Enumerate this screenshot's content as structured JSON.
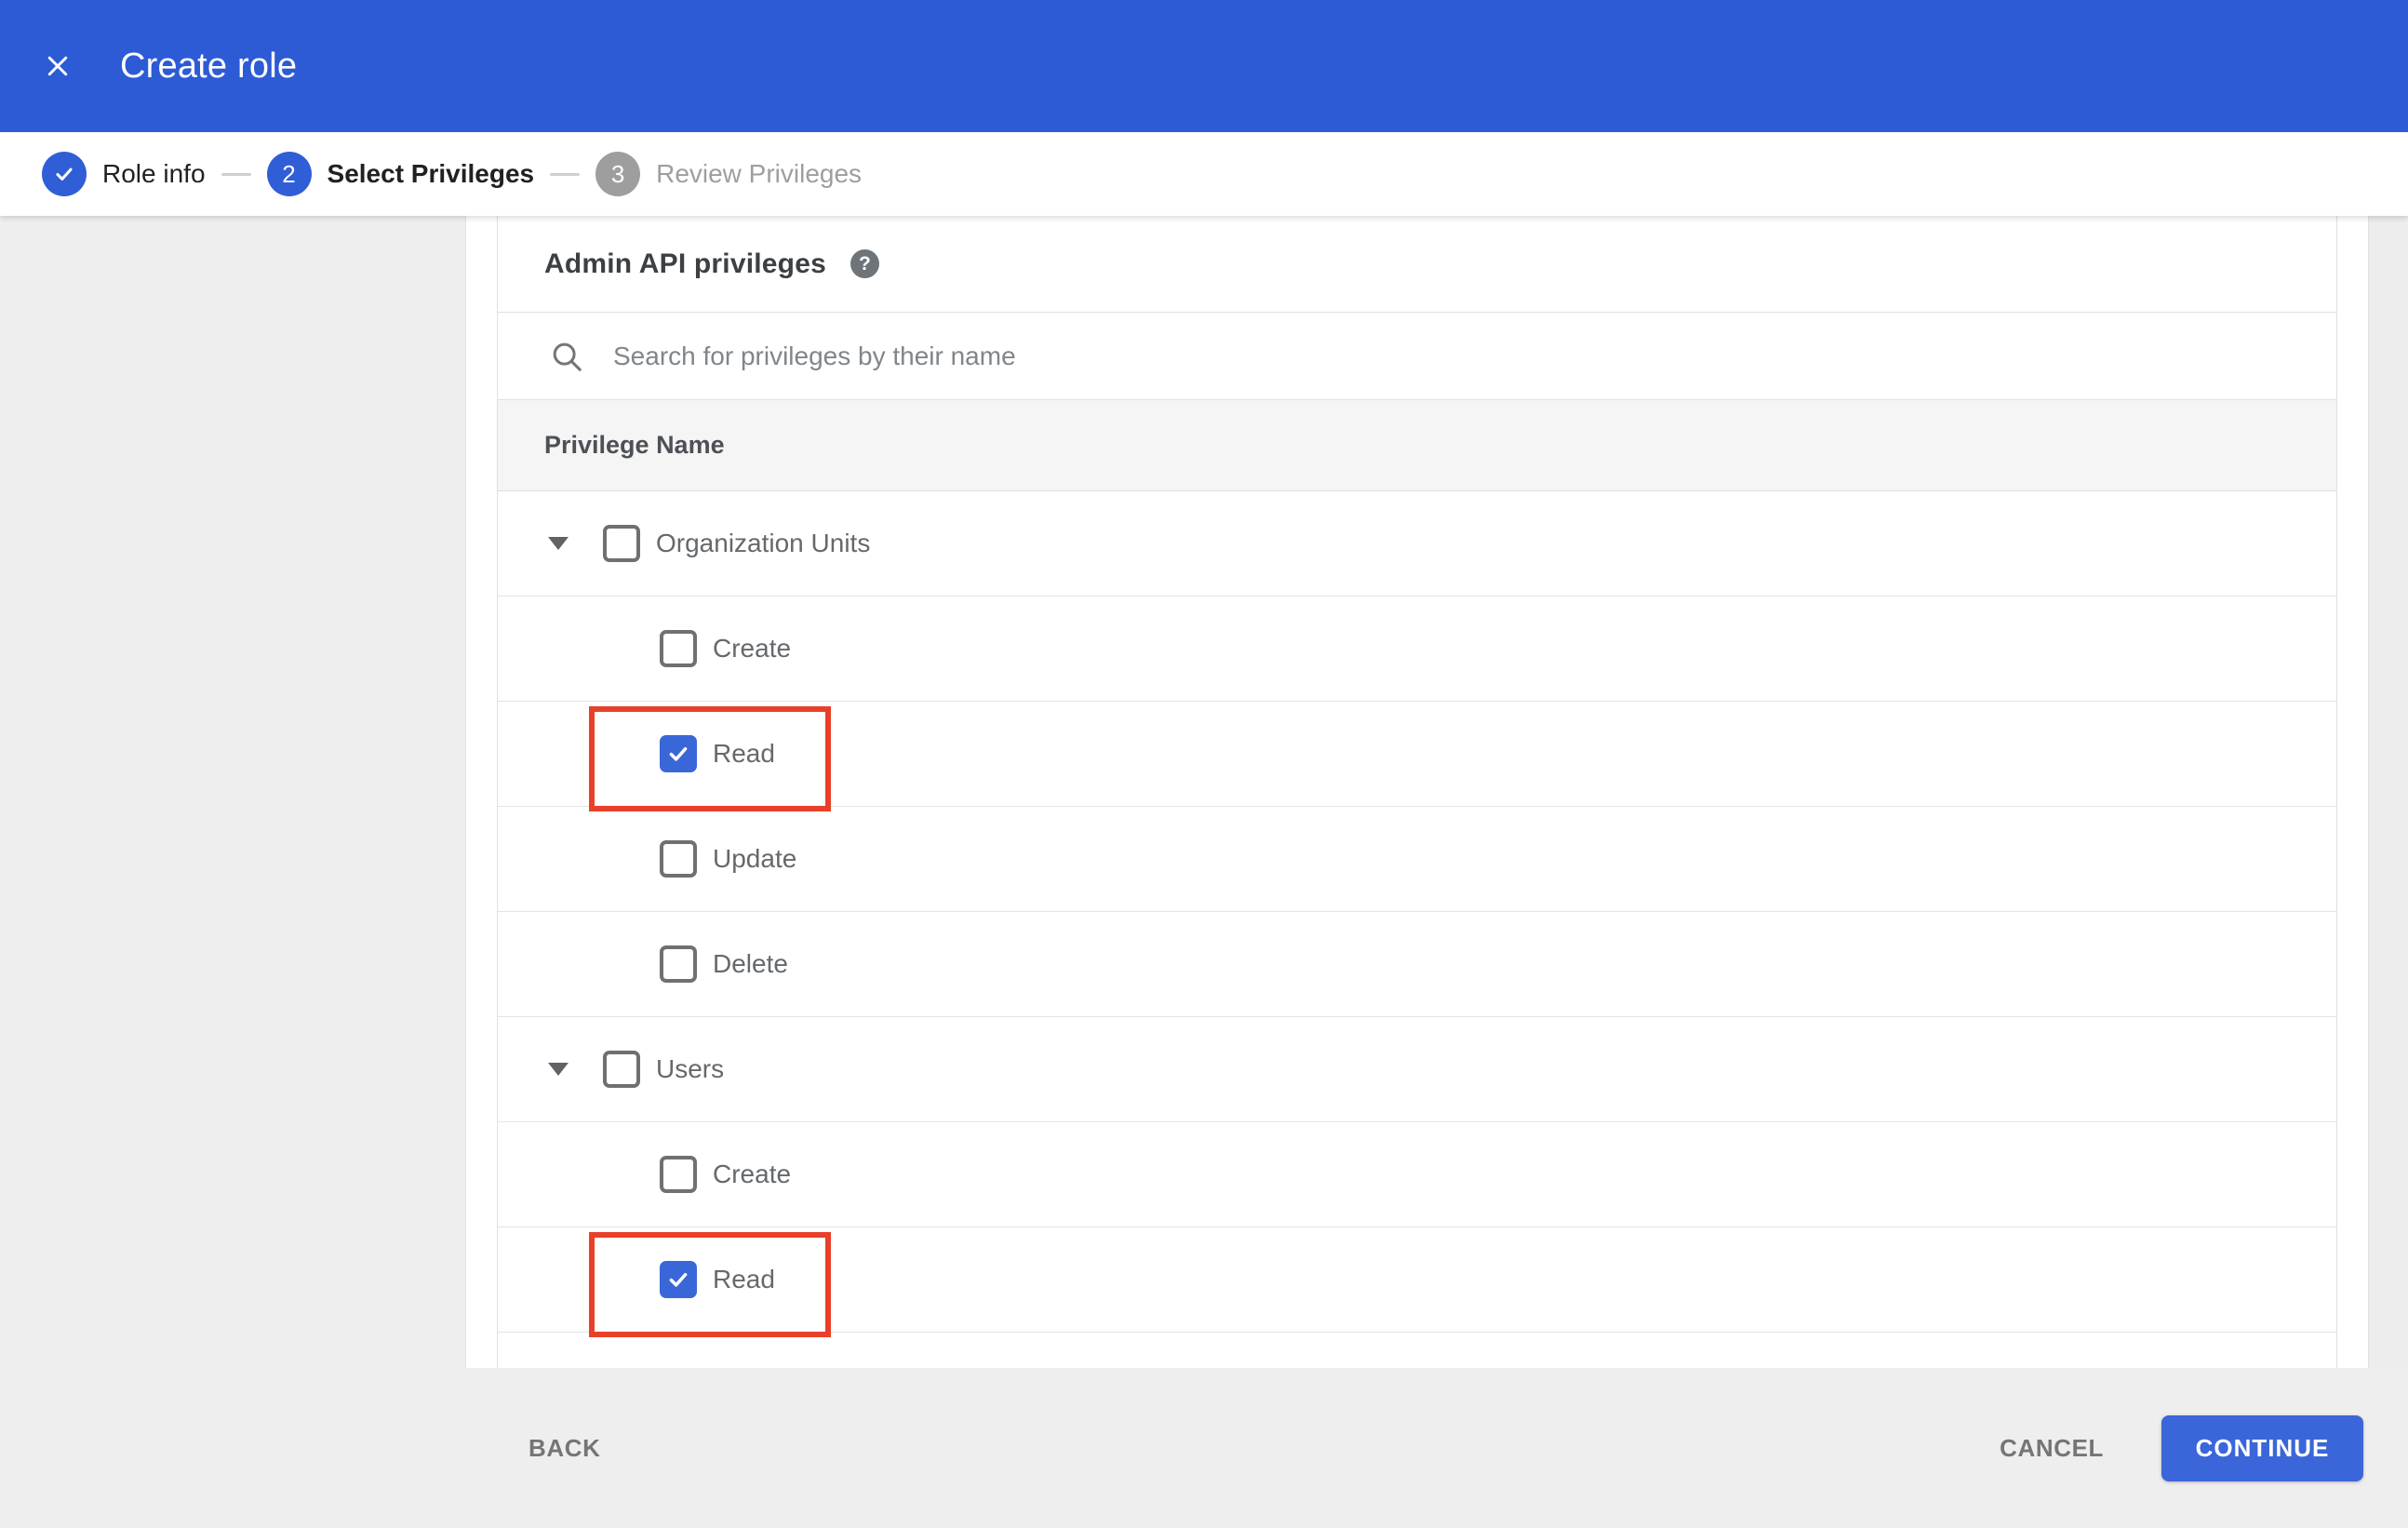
{
  "app_bar": {
    "title": "Create role"
  },
  "stepper": {
    "steps": [
      {
        "label": "Role info",
        "state": "completed"
      },
      {
        "label": "Select Privileges",
        "state": "active",
        "number": "2"
      },
      {
        "label": "Review Privileges",
        "state": "upcoming",
        "number": "3"
      }
    ]
  },
  "privileges_panel": {
    "title": "Admin API privileges",
    "help_icon_text": "?",
    "search_placeholder": "Search for privileges by their name",
    "table": {
      "header": "Privilege Name",
      "groups": [
        {
          "label": "Organization Units",
          "checked": false,
          "expanded": true,
          "children": [
            {
              "label": "Create",
              "checked": false
            },
            {
              "label": "Read",
              "checked": true,
              "highlighted": true
            },
            {
              "label": "Update",
              "checked": false
            },
            {
              "label": "Delete",
              "checked": false
            }
          ]
        },
        {
          "label": "Users",
          "checked": false,
          "expanded": true,
          "children": [
            {
              "label": "Create",
              "checked": false
            },
            {
              "label": "Read",
              "checked": true,
              "highlighted": true
            }
          ]
        }
      ]
    }
  },
  "footer": {
    "back_label": "BACK",
    "cancel_label": "CANCEL",
    "continue_label": "CONTINUE"
  },
  "colors": {
    "app_bar_blue": "#2d5bd6",
    "accent_blue": "#3a67d8",
    "highlight_red": "#e8402a",
    "inactive_step_gray": "#9e9e9e",
    "panel_gray": "#eeeeee"
  }
}
